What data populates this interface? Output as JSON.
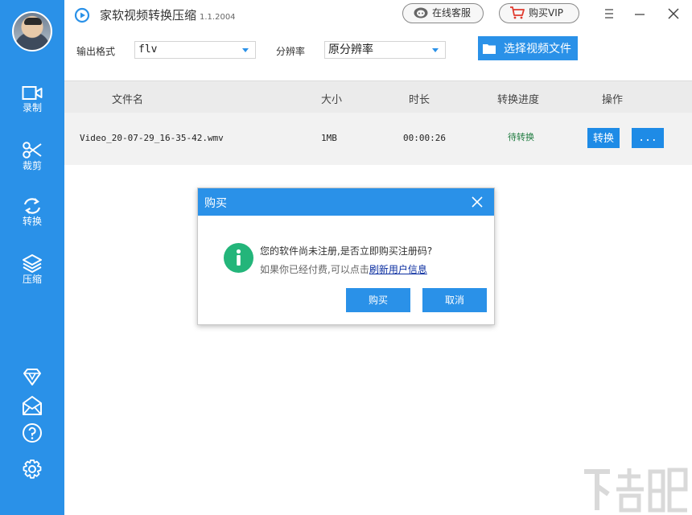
{
  "app": {
    "title": "家软视频转换压缩",
    "version": "1.1.2004"
  },
  "header": {
    "service_label": "在线客服",
    "vip_label": "购买VIP"
  },
  "sidebar": {
    "items": [
      {
        "label": "录制",
        "icon": "video-camera-icon"
      },
      {
        "label": "裁剪",
        "icon": "scissors-icon"
      },
      {
        "label": "转换",
        "icon": "convert-icon"
      },
      {
        "label": "压缩",
        "icon": "layers-icon"
      }
    ],
    "bottom_icons": [
      "diamond-icon",
      "mail-icon",
      "help-icon",
      "settings-icon"
    ]
  },
  "toolbar": {
    "format_label": "输出格式",
    "format_value": "flv",
    "resolution_label": "分辨率",
    "resolution_value": "原分辨率",
    "select_file_label": "选择视频文件"
  },
  "table": {
    "headers": [
      "文件名",
      "大小",
      "时长",
      "转换进度",
      "操作"
    ],
    "rows": [
      {
        "filename": "Video_20-07-29_16-35-42.wmv",
        "size": "1MB",
        "duration": "00:00:26",
        "status": "待转换",
        "convert_label": "转换",
        "more_label": "..."
      }
    ]
  },
  "dialog": {
    "title": "购买",
    "message": "您的软件尚未注册,是否立即购买注册码?",
    "sub_prefix": "如果你已经付费,可以点击",
    "link": "刷新用户信息",
    "buy_label": "购买",
    "cancel_label": "取消"
  },
  "colors": {
    "accent": "#2a91e8",
    "status_green": "#1d7a3e",
    "info_green": "#23b57a",
    "link": "#0b2ea0"
  }
}
